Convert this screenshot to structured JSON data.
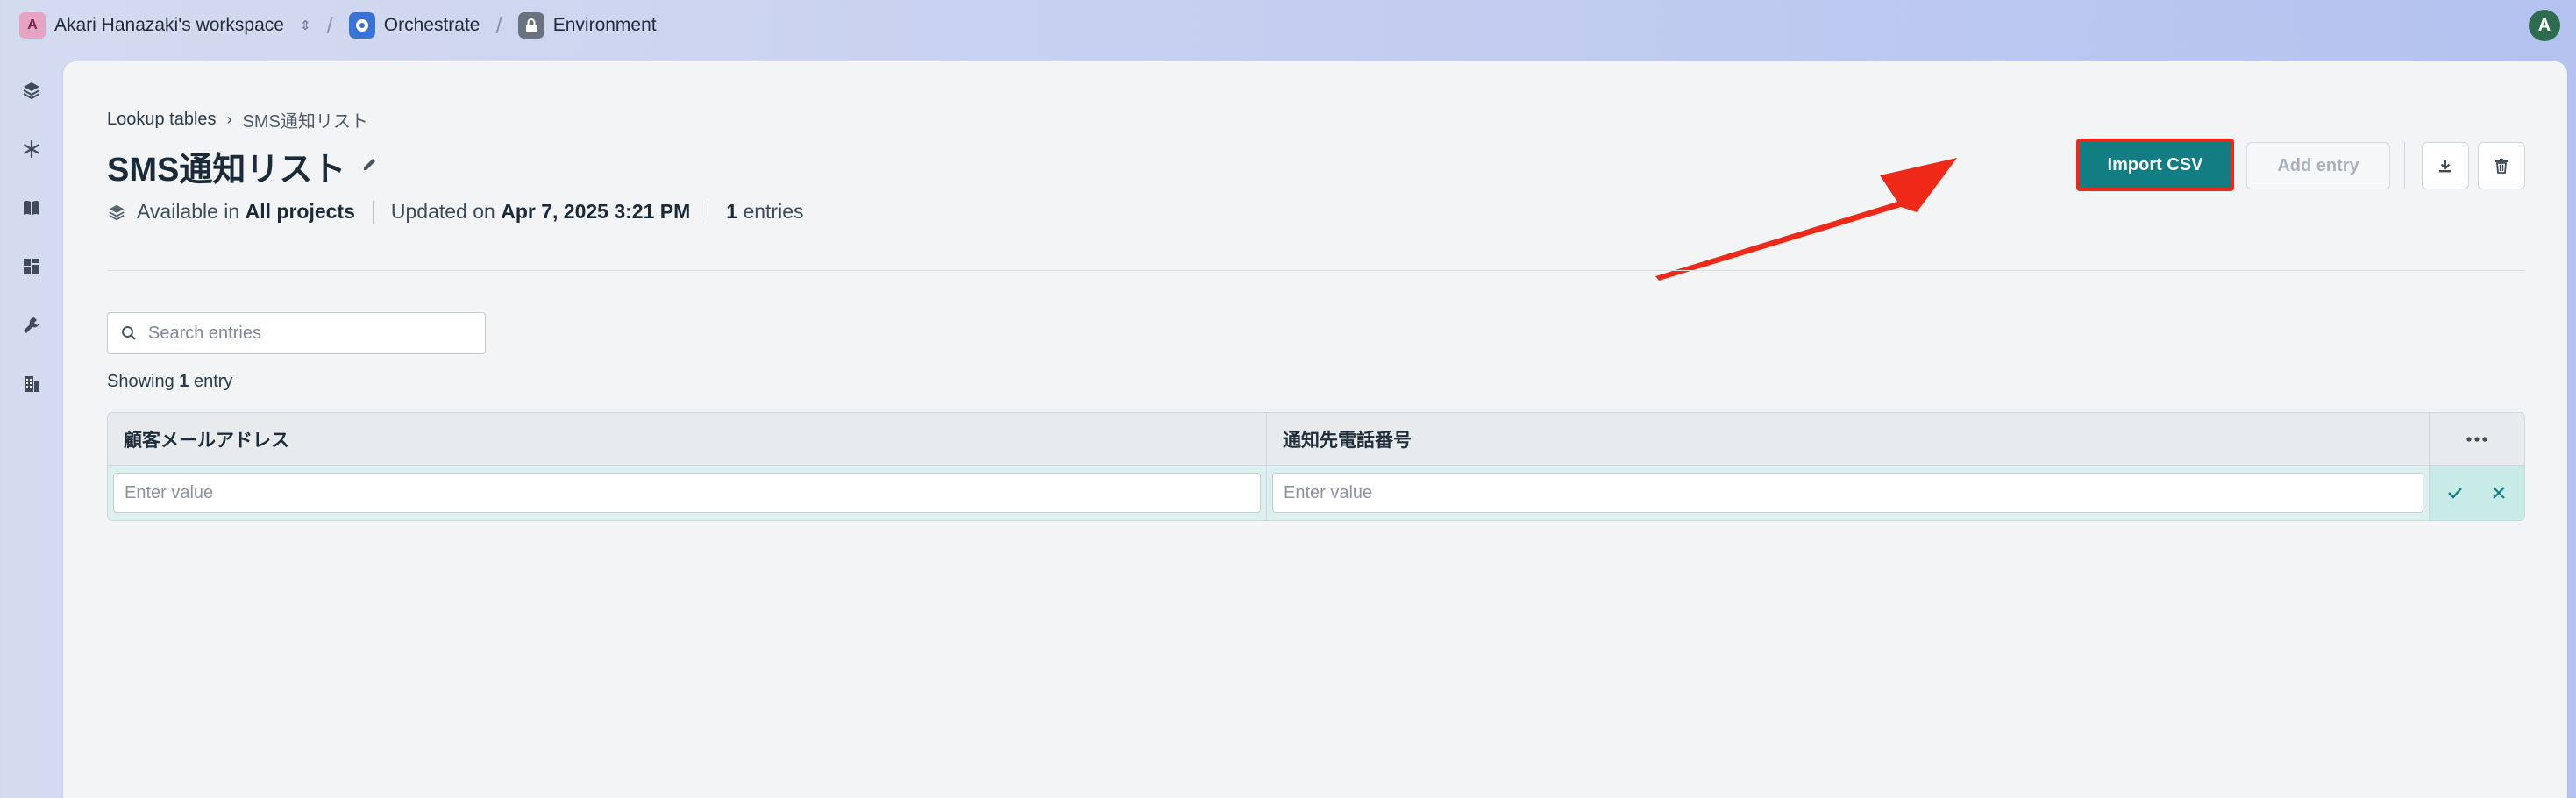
{
  "topbar": {
    "workspace_initial": "A",
    "workspace_name": "Akari Hanazaki's workspace",
    "app_name": "Orchestrate",
    "section_name": "Environment",
    "user_initial": "A"
  },
  "sidebar": {
    "items": [
      {
        "icon": "layers-icon"
      },
      {
        "icon": "snowflake-icon"
      },
      {
        "icon": "book-icon"
      },
      {
        "icon": "dashboard-icon"
      },
      {
        "icon": "wrench-icon"
      },
      {
        "icon": "building-icon"
      }
    ]
  },
  "breadcrumb": {
    "parent": "Lookup tables",
    "current": "SMS通知リスト"
  },
  "page": {
    "title": "SMS通知リスト",
    "available_prefix": "Available in",
    "available_value": "All projects",
    "updated_prefix": "Updated on",
    "updated_value": "Apr 7, 2025 3:21 PM",
    "entries_count": "1",
    "entries_suffix": "entries"
  },
  "actions": {
    "import_label": "Import CSV",
    "add_label": "Add entry"
  },
  "search": {
    "placeholder": "Search entries"
  },
  "listing": {
    "showing_prefix": "Showing",
    "showing_count": "1",
    "showing_suffix": "entry"
  },
  "table": {
    "columns": [
      "顧客メールアドレス",
      "通知先電話番号"
    ],
    "new_row_placeholders": [
      "Enter value",
      "Enter value"
    ]
  },
  "colors": {
    "primary": "#127d82",
    "annotation_red": "#f02818",
    "new_row_bg": "#dcf0ef"
  }
}
